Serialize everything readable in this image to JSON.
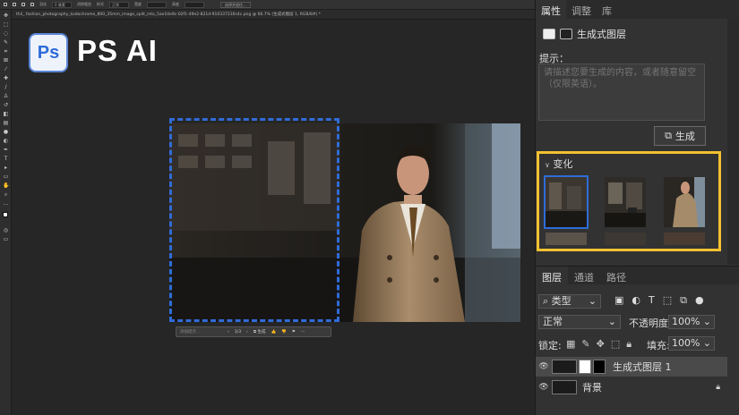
{
  "options_bar": {
    "feather_label": "羽化",
    "feather_value": "0 像素",
    "antialias_label": "消除锯齿",
    "style_label": "样式",
    "style_value": "正常",
    "width_label": "宽度",
    "height_label": "高度",
    "select_mask_label": "选择并遮住..."
  },
  "document_tab": {
    "title": "thil_ fashion_photography_kodachrome_800_35mm_image_split_into_5ae10e9c-02f1-49e2-821d-910337230c4c.png @ 66.7% (生成式图层 1, RGB/8#) *"
  },
  "overlay": {
    "logo_letters": "Ps",
    "title": "PS AI"
  },
  "context_bar": {
    "prompt_placeholder": "添加提示...",
    "page": "1/3",
    "generate_label": "生成"
  },
  "properties": {
    "tabs": [
      "属性",
      "调整",
      "库"
    ],
    "layer_type": "生成式图层",
    "prompt_label": "提示：",
    "prompt_placeholder": "请描述您要生成的内容，或者随意留空（仅限英语）。",
    "generate_button": "生成",
    "variations_label": "变化"
  },
  "layers_panel": {
    "tabs": [
      "图层",
      "通道",
      "路径"
    ],
    "kind_label": "类型",
    "blend_mode": "正常",
    "opacity_label": "不透明度:",
    "opacity_value": "100%",
    "lock_label": "锁定:",
    "fill_label": "填充:",
    "fill_value": "100%",
    "layers": [
      {
        "name": "生成式图层 1"
      },
      {
        "name": "背景"
      }
    ]
  },
  "colors": {
    "selection": "#2f6cd8",
    "highlight": "#f2c131"
  }
}
